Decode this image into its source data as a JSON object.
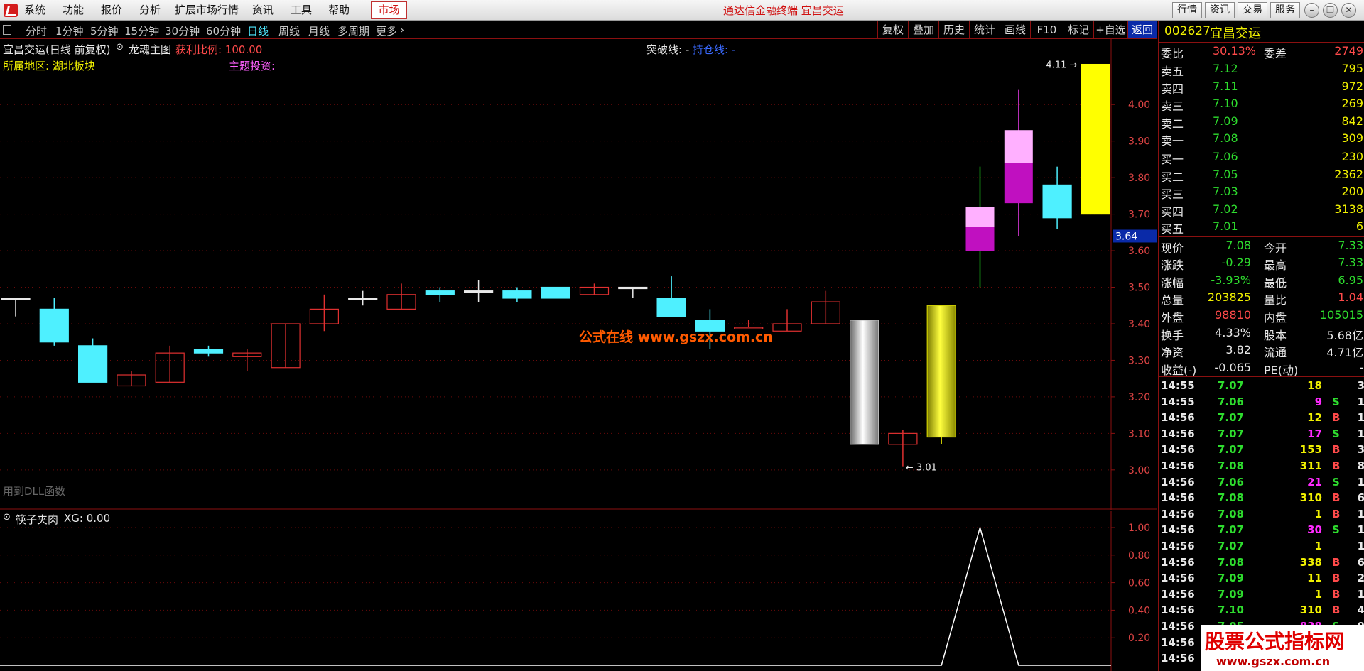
{
  "menubar": {
    "items": [
      "系统",
      "功能",
      "报价",
      "分析",
      "扩展市场行情",
      "资讯",
      "工具",
      "帮助"
    ],
    "market_button": "市场",
    "app_title": "通达信金融终端  宜昌交运",
    "right_buttons": [
      "行情",
      "资讯",
      "交易",
      "服务"
    ]
  },
  "period_bar": {
    "periods": [
      "分时",
      "1分钟",
      "5分钟",
      "15分钟",
      "30分钟",
      "60分钟",
      "日线",
      "周线",
      "月线",
      "多周期",
      "更多"
    ],
    "active": "日线",
    "right_buttons": [
      "复权",
      "叠加",
      "历史",
      "统计",
      "画线",
      "F10",
      "标记",
      "+自选",
      "返回"
    ],
    "right_active": "返回"
  },
  "main_chart": {
    "header": "宜昌交运(日线 前复权)",
    "main_indicator": "龙魂主图",
    "profit_label": "获利比例: 100.00",
    "breakout_label": "突破线: -",
    "hold_label": "持仓线: -",
    "region": "所属地区: 湖北板块",
    "theme": "主题投资:",
    "dll_note": "用到DLL函数",
    "watermark": "公式在线  www.gszx.com.cn",
    "max_marker": "4.11",
    "min_marker": "3.01",
    "current_price_tag": "3.64",
    "y_axis_labels": [
      "4.00",
      "3.90",
      "3.80",
      "3.70",
      "3.60",
      "3.50",
      "3.40",
      "3.30",
      "3.20",
      "3.10",
      "3.00"
    ]
  },
  "indicator_chart": {
    "title": "筷子夹肉",
    "value_label": "XG: 0.00",
    "y_axis_labels": [
      "1.00",
      "0.80",
      "0.60",
      "0.40",
      "0.20"
    ]
  },
  "chart_data": {
    "type": "candlestick",
    "ylim": [
      2.92,
      4.15
    ],
    "candles": [
      {
        "o": 3.47,
        "h": 3.47,
        "l": 3.42,
        "c": 3.47,
        "color": "white"
      },
      {
        "o": 3.44,
        "h": 3.47,
        "l": 3.34,
        "c": 3.35,
        "color": "cyan"
      },
      {
        "o": 3.34,
        "h": 3.36,
        "l": 3.24,
        "c": 3.24,
        "color": "cyan"
      },
      {
        "o": 3.23,
        "h": 3.27,
        "l": 3.23,
        "c": 3.26,
        "color": "red"
      },
      {
        "o": 3.24,
        "h": 3.34,
        "l": 3.24,
        "c": 3.32,
        "color": "red"
      },
      {
        "o": 3.32,
        "h": 3.34,
        "l": 3.31,
        "c": 3.33,
        "color": "cyan"
      },
      {
        "o": 3.31,
        "h": 3.33,
        "l": 3.27,
        "c": 3.32,
        "color": "red"
      },
      {
        "o": 3.28,
        "h": 3.4,
        "l": 3.28,
        "c": 3.4,
        "color": "red"
      },
      {
        "o": 3.4,
        "h": 3.48,
        "l": 3.38,
        "c": 3.44,
        "color": "red"
      },
      {
        "o": 3.47,
        "h": 3.49,
        "l": 3.45,
        "c": 3.47,
        "color": "white"
      },
      {
        "o": 3.44,
        "h": 3.51,
        "l": 3.44,
        "c": 3.48,
        "color": "red"
      },
      {
        "o": 3.49,
        "h": 3.5,
        "l": 3.46,
        "c": 3.48,
        "color": "cyan"
      },
      {
        "o": 3.49,
        "h": 3.52,
        "l": 3.46,
        "c": 3.49,
        "color": "white"
      },
      {
        "o": 3.49,
        "h": 3.5,
        "l": 3.46,
        "c": 3.47,
        "color": "cyan"
      },
      {
        "o": 3.5,
        "h": 3.5,
        "l": 3.47,
        "c": 3.47,
        "color": "cyan"
      },
      {
        "o": 3.48,
        "h": 3.51,
        "l": 3.48,
        "c": 3.5,
        "color": "red"
      },
      {
        "o": 3.5,
        "h": 3.5,
        "l": 3.47,
        "c": 3.5,
        "color": "white"
      },
      {
        "o": 3.47,
        "h": 3.53,
        "l": 3.42,
        "c": 3.42,
        "color": "cyan"
      },
      {
        "o": 3.41,
        "h": 3.44,
        "l": 3.33,
        "c": 3.38,
        "color": "cyan"
      },
      {
        "o": 3.39,
        "h": 3.41,
        "l": 3.39,
        "c": 3.39,
        "color": "red"
      },
      {
        "o": 3.38,
        "h": 3.44,
        "l": 3.38,
        "c": 3.4,
        "color": "red"
      },
      {
        "o": 3.4,
        "h": 3.49,
        "l": 3.4,
        "c": 3.46,
        "color": "red"
      },
      {
        "o": 3.41,
        "h": 3.41,
        "l": 3.07,
        "c": 3.07,
        "color": "silver"
      },
      {
        "o": 3.07,
        "h": 3.11,
        "l": 3.01,
        "c": 3.1,
        "color": "red"
      },
      {
        "o": 3.09,
        "h": 3.45,
        "l": 3.07,
        "c": 3.45,
        "color": "gold"
      },
      {
        "o": 3.6,
        "h": 3.83,
        "l": 3.5,
        "c": 3.72,
        "color": "pink"
      },
      {
        "o": 3.73,
        "h": 4.04,
        "l": 3.64,
        "c": 3.93,
        "color": "pink"
      },
      {
        "o": 3.69,
        "h": 3.83,
        "l": 3.66,
        "c": 3.78,
        "color": "cyan"
      },
      {
        "o": 3.7,
        "h": 4.11,
        "l": 3.7,
        "c": 4.11,
        "color": "yellow"
      }
    ],
    "indicator": {
      "name": "XG",
      "values": [
        0,
        0,
        0,
        0,
        0,
        0,
        0,
        0,
        0,
        0,
        0,
        0,
        0,
        0,
        0,
        0,
        0,
        0,
        0,
        0,
        0,
        0,
        0,
        0,
        0,
        1,
        0,
        0,
        0
      ],
      "ylim": [
        0,
        1.0
      ]
    }
  },
  "quote_panel": {
    "code": "002627",
    "name": "宜昌交运",
    "wei_bi_label": "委比",
    "wei_bi_value": "30.13%",
    "wei_cha_label": "委差",
    "wei_cha_value": "2749",
    "asks": [
      {
        "label": "卖五",
        "price": "7.12",
        "vol": "795"
      },
      {
        "label": "卖四",
        "price": "7.11",
        "vol": "972"
      },
      {
        "label": "卖三",
        "price": "7.10",
        "vol": "269"
      },
      {
        "label": "卖二",
        "price": "7.09",
        "vol": "842"
      },
      {
        "label": "卖一",
        "price": "7.08",
        "vol": "309"
      }
    ],
    "bids": [
      {
        "label": "买一",
        "price": "7.06",
        "vol": "230"
      },
      {
        "label": "买二",
        "price": "7.05",
        "vol": "2362"
      },
      {
        "label": "买三",
        "price": "7.03",
        "vol": "200"
      },
      {
        "label": "买四",
        "price": "7.02",
        "vol": "3138"
      },
      {
        "label": "买五",
        "price": "7.01",
        "vol": "6"
      }
    ],
    "stats1": [
      {
        "l1": "现价",
        "v1": "7.08",
        "c1": "green",
        "l2": "今开",
        "v2": "7.33",
        "c2": "green"
      },
      {
        "l1": "涨跌",
        "v1": "-0.29",
        "c1": "green",
        "l2": "最高",
        "v2": "7.33",
        "c2": "green"
      },
      {
        "l1": "涨幅",
        "v1": "-3.93%",
        "c1": "green",
        "l2": "最低",
        "v2": "6.95",
        "c2": "green"
      },
      {
        "l1": "总量",
        "v1": "203825",
        "c1": "yellow",
        "l2": "量比",
        "v2": "1.04",
        "c2": "red"
      },
      {
        "l1": "外盘",
        "v1": "98810",
        "c1": "red",
        "l2": "内盘",
        "v2": "105015",
        "c2": "green"
      }
    ],
    "stats2": [
      {
        "l1": "换手",
        "v1": "4.33%",
        "l2": "股本",
        "v2": "5.68亿"
      },
      {
        "l1": "净资",
        "v1": "3.82",
        "l2": "流通",
        "v2": "4.71亿"
      },
      {
        "l1": "收益(-)",
        "v1": "-0.065",
        "l2": "PE(动)",
        "v2": "-"
      }
    ],
    "ticks": [
      {
        "time": "14:55",
        "price": "7.07",
        "pc": "green",
        "vol": "18",
        "bs": "",
        "n": "3"
      },
      {
        "time": "14:55",
        "price": "7.06",
        "pc": "green",
        "vol": "9",
        "bs": "S",
        "n": "1"
      },
      {
        "time": "14:56",
        "price": "7.07",
        "pc": "green",
        "vol": "12",
        "bs": "B",
        "n": "1"
      },
      {
        "time": "14:56",
        "price": "7.07",
        "pc": "green",
        "vol": "17",
        "bs": "S",
        "n": "1"
      },
      {
        "time": "14:56",
        "price": "7.07",
        "pc": "green",
        "vol": "153",
        "bs": "B",
        "n": "3"
      },
      {
        "time": "14:56",
        "price": "7.08",
        "pc": "green",
        "vol": "311",
        "bs": "B",
        "n": "8"
      },
      {
        "time": "14:56",
        "price": "7.06",
        "pc": "green",
        "vol": "21",
        "bs": "S",
        "n": "1"
      },
      {
        "time": "14:56",
        "price": "7.08",
        "pc": "green",
        "vol": "310",
        "bs": "B",
        "n": "6"
      },
      {
        "time": "14:56",
        "price": "7.08",
        "pc": "green",
        "vol": "1",
        "bs": "B",
        "n": "1"
      },
      {
        "time": "14:56",
        "price": "7.07",
        "pc": "green",
        "vol": "30",
        "bs": "S",
        "n": "1"
      },
      {
        "time": "14:56",
        "price": "7.07",
        "pc": "green",
        "vol": "1",
        "bs": "",
        "n": "1"
      },
      {
        "time": "14:56",
        "price": "7.08",
        "pc": "green",
        "vol": "338",
        "bs": "B",
        "n": "6"
      },
      {
        "time": "14:56",
        "price": "7.09",
        "pc": "green",
        "vol": "11",
        "bs": "B",
        "n": "2"
      },
      {
        "time": "14:56",
        "price": "7.09",
        "pc": "green",
        "vol": "1",
        "bs": "B",
        "n": "1"
      },
      {
        "time": "14:56",
        "price": "7.10",
        "pc": "green",
        "vol": "310",
        "bs": "B",
        "n": "4"
      },
      {
        "time": "14:56",
        "price": "7.05",
        "pc": "green",
        "vol": "838",
        "bs": "S",
        "n": "9"
      },
      {
        "time": "14:56",
        "price": "",
        "pc": "green",
        "vol": "",
        "bs": "",
        "n": ""
      },
      {
        "time": "14:56",
        "price": "",
        "pc": "green",
        "vol": "",
        "bs": "",
        "n": ""
      }
    ]
  },
  "watermark": {
    "title": "股票公式指标网",
    "url": "www.gszx.com.cn"
  },
  "colors": {
    "axis_red": "#8b1010",
    "up_red": "#e03030",
    "down_cyan": "#4ef0ff",
    "price_yellow": "#f0f000",
    "accent_blue": "#0a2aa8"
  }
}
